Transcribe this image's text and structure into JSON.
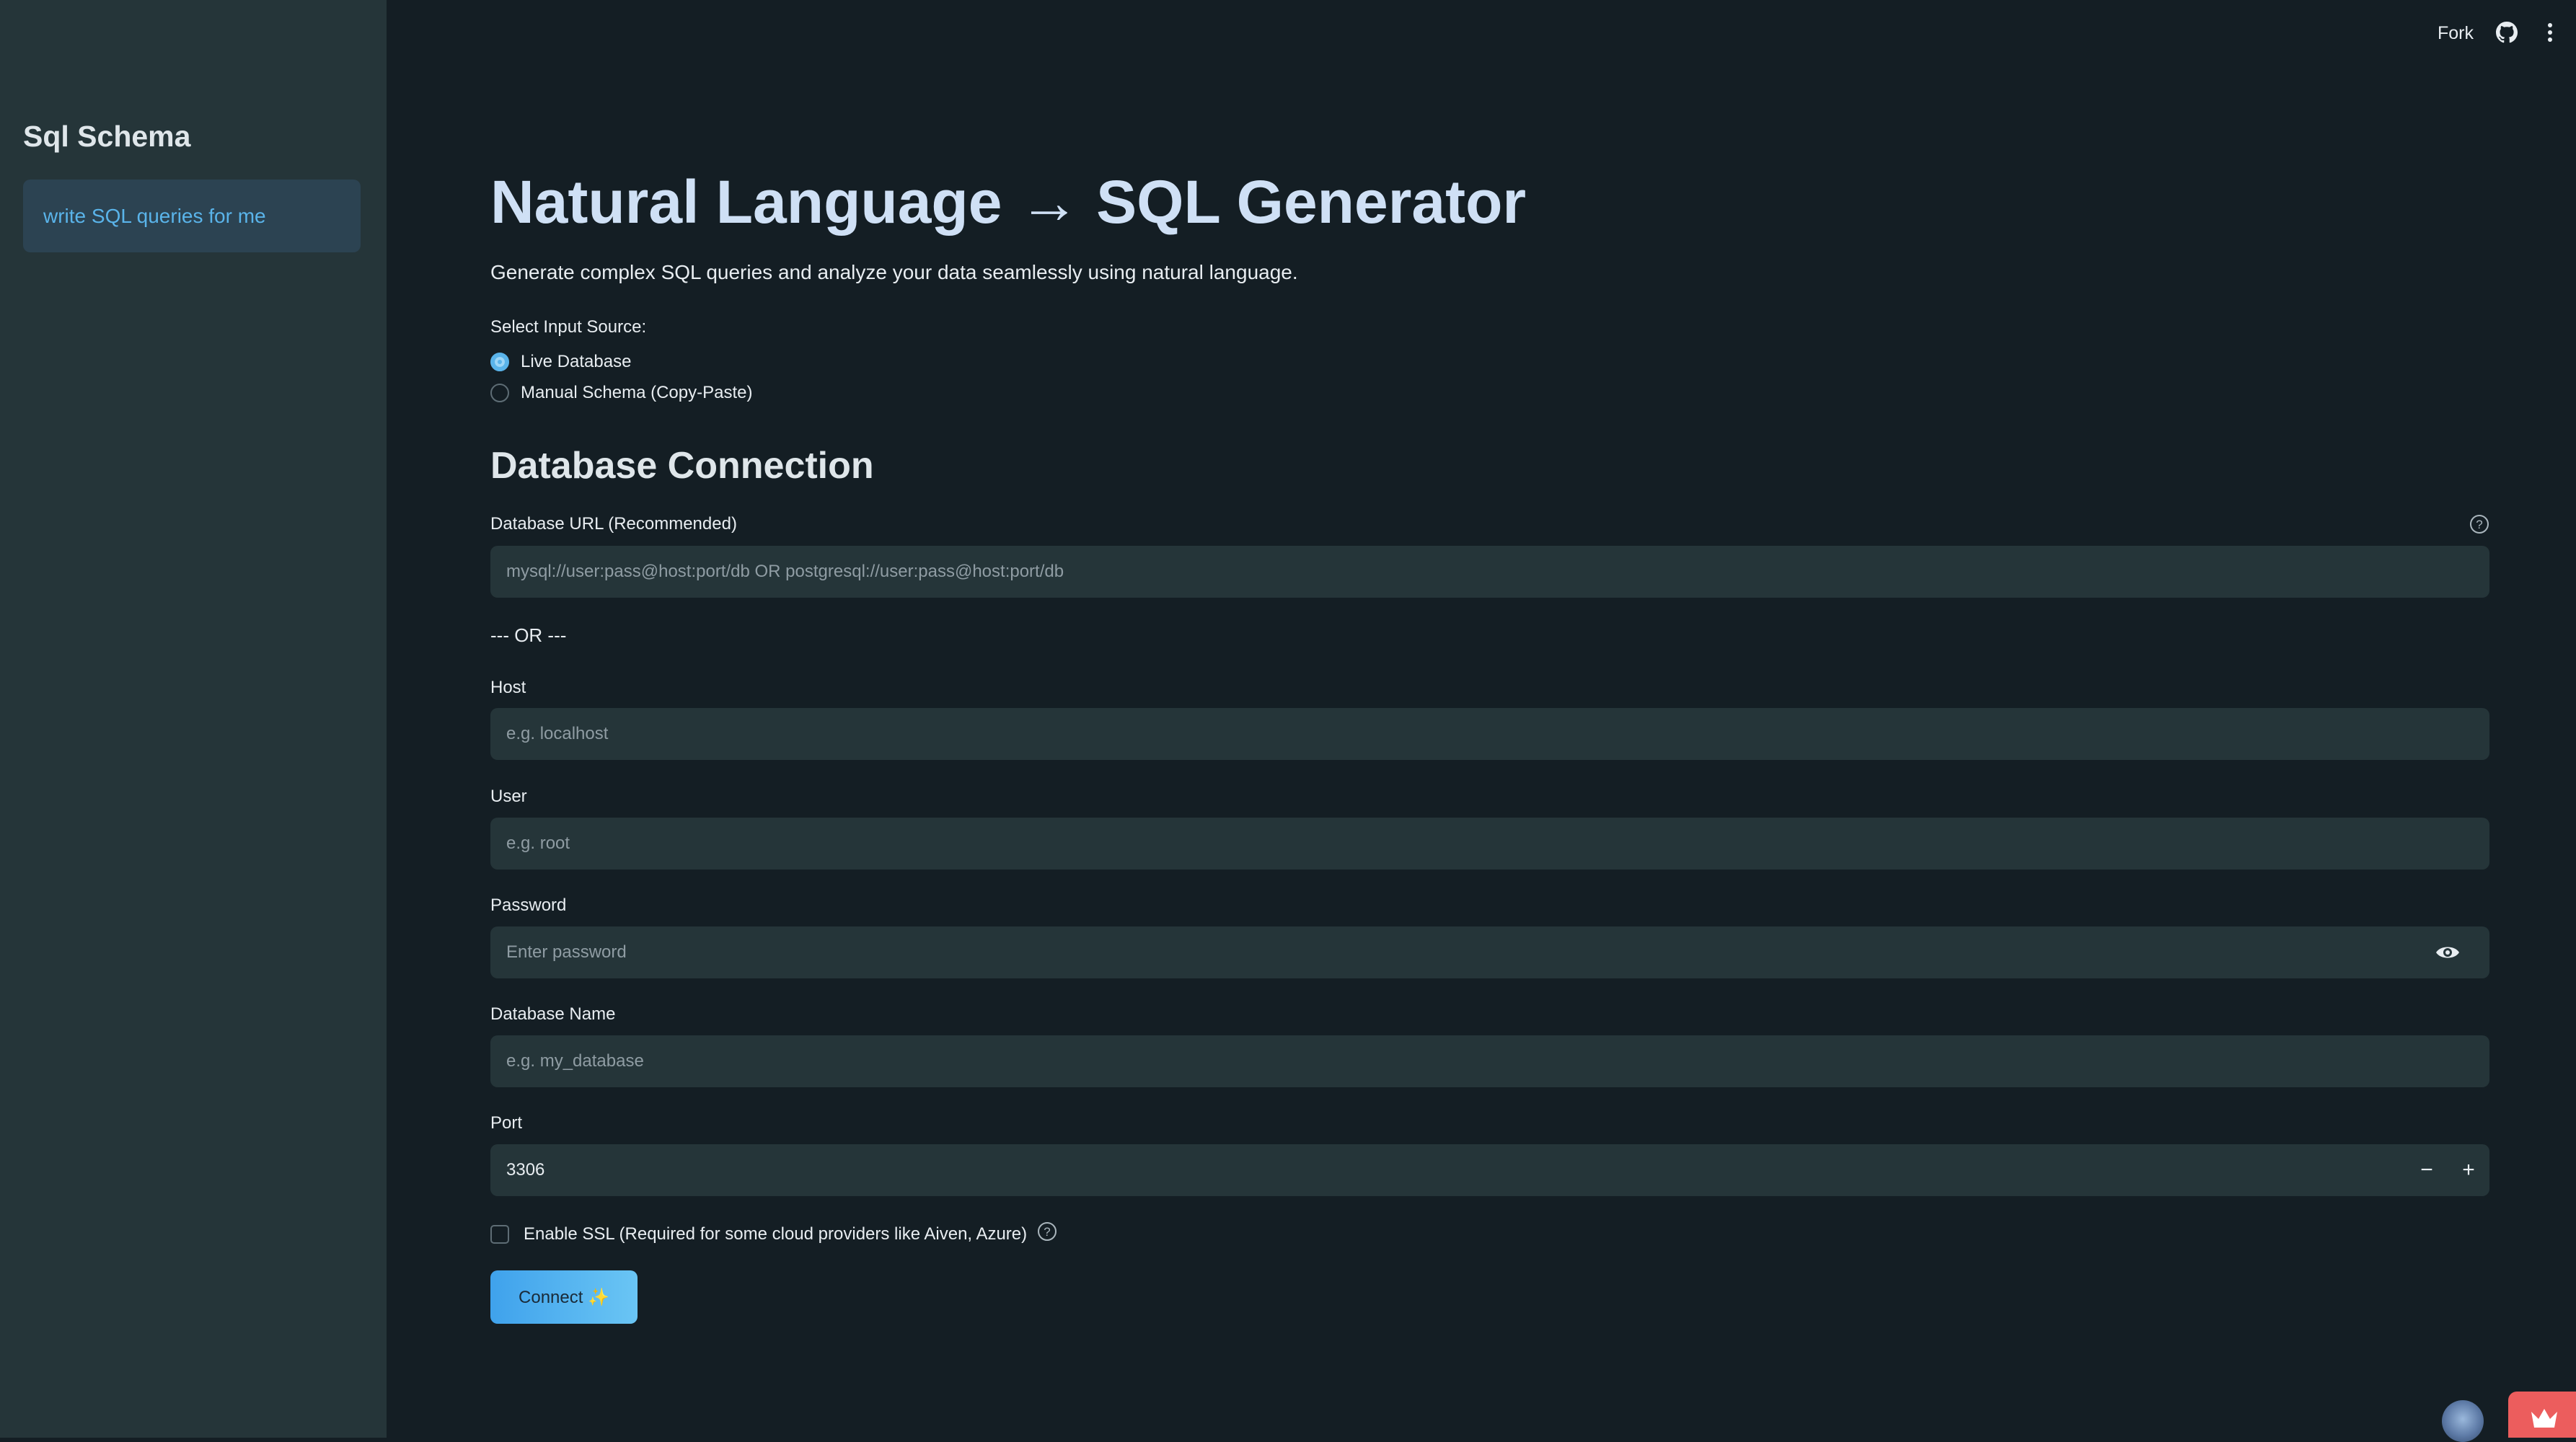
{
  "sidebar": {
    "title": "Sql Schema",
    "nav_item": "write SQL queries for me"
  },
  "topbar": {
    "fork_label": "Fork",
    "icons": [
      "github-icon",
      "kebab-menu-icon"
    ]
  },
  "main": {
    "title": "Natural Language → SQL Generator",
    "subtitle": "Generate complex SQL queries and analyze your data seamlessly using natural language.",
    "input_source": {
      "label": "Select Input Source:",
      "options": [
        "Live Database",
        "Manual Schema (Copy-Paste)"
      ],
      "selected": "Live Database"
    },
    "section_title": "Database Connection",
    "db_url": {
      "label": "Database URL (Recommended)",
      "placeholder": "mysql://user:pass@host:port/db OR postgresql://user:pass@host:port/db"
    },
    "separator": "--- OR ---",
    "host": {
      "label": "Host",
      "placeholder": "e.g. localhost"
    },
    "user": {
      "label": "User",
      "placeholder": "e.g. root"
    },
    "password": {
      "label": "Password",
      "placeholder": "Enter password"
    },
    "db_name": {
      "label": "Database Name",
      "placeholder": "e.g. my_database"
    },
    "port": {
      "label": "Port",
      "value": "3306",
      "decrement": "−",
      "increment": "+"
    },
    "ssl": {
      "label": "Enable SSL (Required for some cloud providers like Aiven, Azure)",
      "checked": false
    },
    "connect_button": "Connect ✨"
  },
  "colors": {
    "background": "#141e24",
    "sidebar": "#253539",
    "accent": "#5ab4ea",
    "title": "#cfe0f5",
    "badge": "#ec5d5d"
  }
}
